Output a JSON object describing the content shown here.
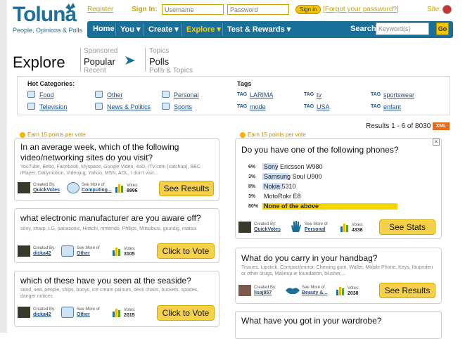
{
  "logo": {
    "name": "Toluna",
    "tagline": "People, Opinions & Polls"
  },
  "topbar": {
    "register": "Register",
    "sign_in_label": "Sign In:",
    "username_placeholder": "Username",
    "password_placeholder": "Password",
    "sign_in_button": "Sign in",
    "forgot": "[Forgot your password?]",
    "site_label": "Site:"
  },
  "nav": {
    "items": [
      "Home",
      "You ▾",
      "Create ▾",
      "Explore ▾",
      "Test & Rewards ▾"
    ],
    "active": "Explore ▾",
    "search_label": "Search:",
    "search_placeholder": "Keyword(s)",
    "go": "Go"
  },
  "crumbs": {
    "title": "Explore",
    "sponsored": "Sponsored",
    "popular": "Popular",
    "recent": "Recent",
    "topics": "Topics",
    "polls": "Polls",
    "polls_topics": "Polls & Topics"
  },
  "categories": {
    "header": "Hot Categories:",
    "items": [
      "Food",
      "Other",
      "Personal",
      "Television",
      "News & Politics",
      "Sports"
    ]
  },
  "tags": {
    "header": "Tags",
    "prefix": "TAG",
    "items": [
      "LARIMA",
      "tv",
      "sportswear",
      "mode",
      "USA",
      "enfant"
    ]
  },
  "results": {
    "text": "Results 1 - 6 of 8030",
    "xml": "XML"
  },
  "colors": {
    "brand": "#1a6f99",
    "accent": "#f5d14a",
    "link": "#1a4f8a"
  },
  "cards": [
    {
      "earn": "Earn 15 points per vote",
      "question": "In an average week, which of the following video/networking sites do you visit?",
      "subtitle": "YouTube, Bebo, Facebook, Myspace, Google Video, 4oD, ITV.com (catchup), BBC iPlayer, Dailymotion, Videojug, Yahoo, MSN, AOL, I don't visit...",
      "created_by_label": "Created By:",
      "creator": "QuickVotes",
      "see_more_label": "See More of",
      "see_more": "Computing...",
      "votes_label": "Votes:",
      "votes": "8996",
      "button": "See Results"
    },
    {
      "question": "what electronic manufacturer are you aware off?",
      "subtitle": "sony, sharp, LG, panasonic, Hitachi, nintendo, Philips, Mitsubusi, grundig, matsui",
      "created_by_label": "Created By:",
      "creator": "dicka42",
      "see_more_label": "See More of",
      "see_more": "Other",
      "votes_label": "Votes:",
      "votes": "3105",
      "button": "Click to Vote"
    },
    {
      "question": "which of these have you seen at the seaside?",
      "subtitle": "sand, sea, people, ships, buoys, ice cream palours, deck chairs, buckets, spades, danger notices",
      "created_by_label": "Created By:",
      "creator": "dicka42",
      "see_more_label": "See More of",
      "see_more": "Other",
      "votes_label": "Votes:",
      "votes": "2015",
      "button": "Click to Vote"
    },
    {
      "earn": "Earn 15 points per vote",
      "question": "Do you have one of the following phones?",
      "close": "×",
      "options": [
        {
          "pct": "6%",
          "brand": "Sony",
          "rest": " Ericsson W980",
          "value": 6
        },
        {
          "pct": "3%",
          "brand": "Samsung",
          "rest": " Soul U900",
          "value": 3
        },
        {
          "pct": "8%",
          "brand": "Nokia",
          "rest": " 5310",
          "value": 8
        },
        {
          "pct": "3%",
          "brand": "",
          "rest": "MotoRokr E8",
          "value": 3
        },
        {
          "pct": "80%",
          "brand": "",
          "rest": "None of the above",
          "value": 80
        }
      ],
      "created_by_label": "Created By:",
      "creator": "QuickVotes",
      "see_more_label": "See More of",
      "see_more": "Personal",
      "votes_label": "Votes:",
      "votes": "4336",
      "button": "See Stats"
    },
    {
      "question": "What do you carry in your handbag?",
      "subtitle": "Tissues, Lipstick, Compact/mirror, Chewing gum, Wallet, Mobile Phone, Keys, Ibuprofen or other drugs, Makeup ie foundation, blusher,...",
      "created_by_label": "Created By:",
      "creator": "lisaj857",
      "see_more_label": "See More of",
      "see_more": "Beauty &...",
      "votes_label": "Votes:",
      "votes": "2038",
      "button": "See Results"
    },
    {
      "question": "What have you got in your wardrobe?"
    }
  ]
}
